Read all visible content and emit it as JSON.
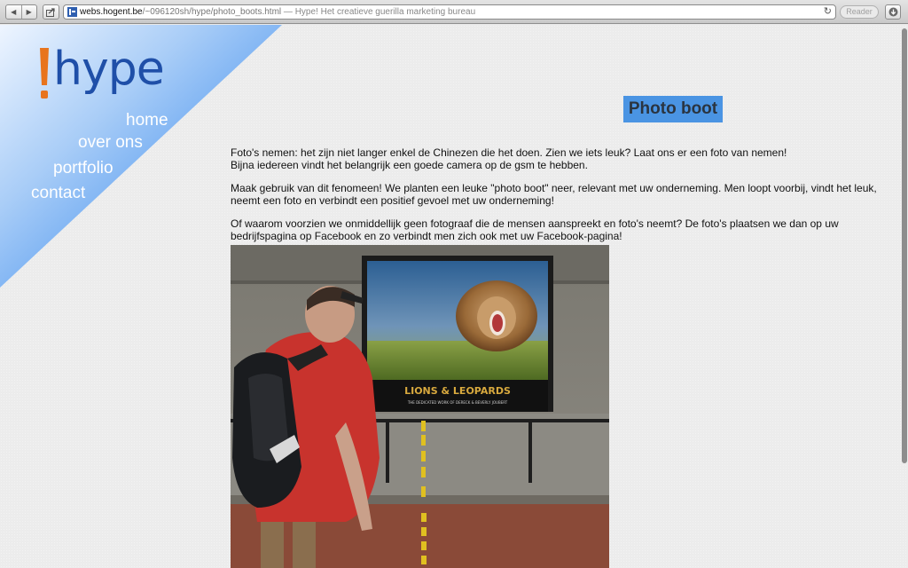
{
  "browser": {
    "url_host": "webs.hogent.be",
    "url_path": "/~096120sh/hype/photo_boots.html",
    "page_title": " — Hype! Het creatieve guerilla marketing bureau",
    "reader_label": "Reader"
  },
  "site": {
    "logo_text": "hype",
    "nav": [
      {
        "label": "home"
      },
      {
        "label": "over ons"
      },
      {
        "label": "portfolio"
      },
      {
        "label": "contact"
      }
    ]
  },
  "main": {
    "title": "Photo boot",
    "paragraphs": [
      {
        "line1": "Foto's nemen: het zijn niet langer enkel de Chinezen die het doen. Zien we iets leuk? Laat ons er een foto van nemen!",
        "line2": "Bijna iedereen vindt het belangrijk een goede camera op de gsm te hebben."
      },
      {
        "line1": "Maak gebruik van dit fenomeen! We planten een leuke \"photo boot\" neer, relevant met uw onderneming. Men loopt voorbij, vindt het leuk,",
        "line2": "neemt een foto en verbindt een positief gevoel met uw onderneming!"
      },
      {
        "line1": "Of waarom voorzien we onmiddellijk geen fotograaf die de mensen aanspreekt en foto's neemt? De foto's plaatsen we dan op uw",
        "line2": "bedrijfspagina op Facebook en zo verbindt men zich ook met uw Facebook-pagina!"
      }
    ],
    "poster_title": "LIONS & LEOPARDS",
    "poster_subtitle": "THE DEDICATED WORK OF DERECK & BEVERLY JOUBERT"
  },
  "colors": {
    "accent_blue": "#4a94e3",
    "logo_blue": "#1f4fa8",
    "logo_orange": "#e8741d"
  }
}
